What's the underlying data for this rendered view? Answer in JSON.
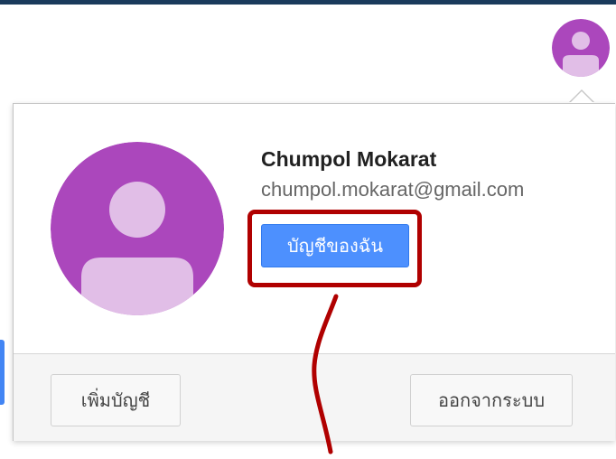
{
  "account": {
    "name": "Chumpol Mokarat",
    "email": "chumpol.mokarat@gmail.com",
    "avatar_icon": "person-avatar-icon",
    "avatar_color": "#ab47bc",
    "avatar_figure_color": "#e1bee7"
  },
  "popup": {
    "my_account_label": "บัญชีของฉัน",
    "add_account_label": "เพิ่มบัญชี",
    "sign_out_label": "ออกจากระบบ"
  },
  "annotation": {
    "highlight_color": "#b00000"
  }
}
